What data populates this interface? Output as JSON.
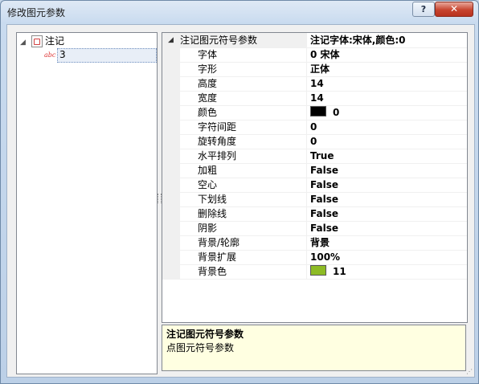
{
  "window": {
    "title": "修改图元参数",
    "help_label": "?",
    "close_label": "✕"
  },
  "tree": {
    "root": {
      "label": "注记",
      "icon": "note-icon",
      "expanded": true
    },
    "child": {
      "icon_text": "abc",
      "label": "3",
      "selected": true
    }
  },
  "property_grid": {
    "category": {
      "name": "注记图元符号参数",
      "value": "注记字体:宋体,颜色:0"
    },
    "rows": [
      {
        "name": "字体",
        "value": "0 宋体"
      },
      {
        "name": "字形",
        "value": "正体"
      },
      {
        "name": "高度",
        "value": "14"
      },
      {
        "name": "宽度",
        "value": "14"
      },
      {
        "name": "颜色",
        "value": "0",
        "swatch_color": "#000000"
      },
      {
        "name": "字符间距",
        "value": "0"
      },
      {
        "name": "旋转角度",
        "value": "0"
      },
      {
        "name": "水平排列",
        "value": "True"
      },
      {
        "name": "加粗",
        "value": "False"
      },
      {
        "name": "空心",
        "value": "False"
      },
      {
        "name": "下划线",
        "value": "False"
      },
      {
        "name": "删除线",
        "value": "False"
      },
      {
        "name": "阴影",
        "value": "False"
      },
      {
        "name": "背景/轮廓",
        "value": "背景"
      },
      {
        "name": "背景扩展",
        "value": "100%"
      },
      {
        "name": "背景色",
        "value": "11",
        "swatch_color": "#8dbb25"
      }
    ]
  },
  "help": {
    "title": "注记图元符号参数",
    "description": "点图元符号参数"
  }
}
